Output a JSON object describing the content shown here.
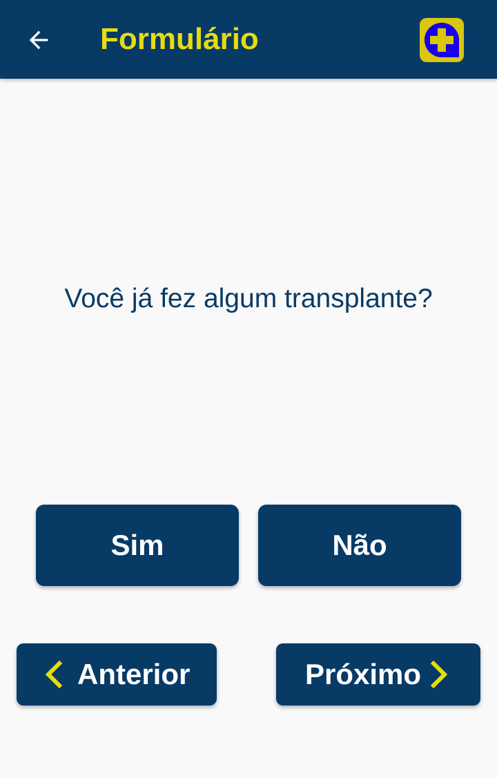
{
  "header": {
    "title": "Formulário",
    "back_icon": "arrow-left-icon",
    "logo_icon": "medical-cross-icon",
    "title_color": "#e6dc0f",
    "bar_color": "#083a66"
  },
  "question": {
    "text": "Você já fez algum transplante?"
  },
  "answers": {
    "yes_label": "Sim",
    "no_label": "Não"
  },
  "navigation": {
    "previous_label": "Anterior",
    "next_label": "Próximo",
    "previous_icon": "chevron-left-icon",
    "next_icon": "chevron-right-icon",
    "chevron_color": "#e6dc0f"
  }
}
